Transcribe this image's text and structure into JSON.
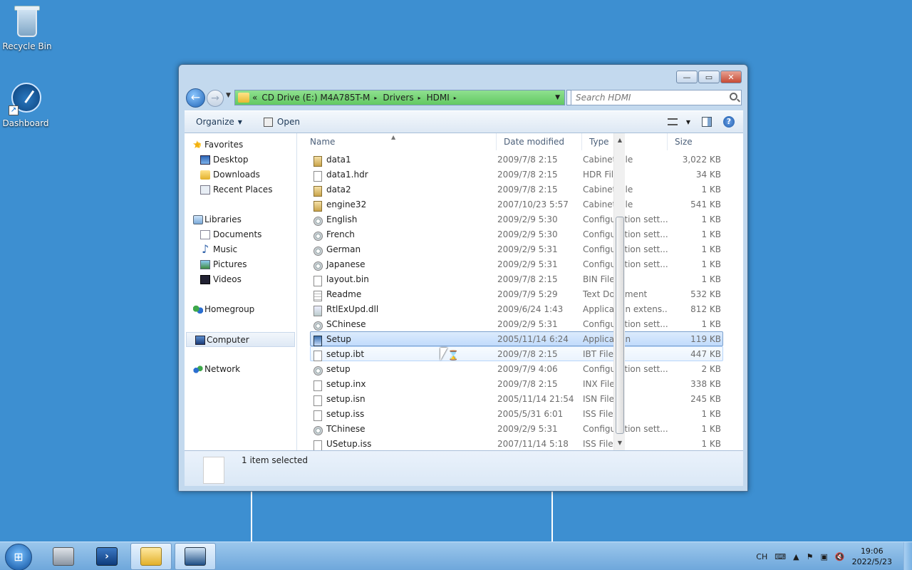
{
  "desktop": {
    "icons": [
      {
        "label": "Recycle Bin",
        "icon": "recycle-bin-icon"
      },
      {
        "label": "Dashboard",
        "icon": "dashboard-icon"
      }
    ]
  },
  "window": {
    "caption": {
      "minimize": "—",
      "maximize": "▭",
      "close": "✕"
    },
    "address": {
      "overflow": "«",
      "segments": [
        "CD Drive (E:) M4A785T-M",
        "Drivers",
        "HDMI"
      ],
      "separator": "▸"
    },
    "search": {
      "placeholder": "Search HDMI"
    },
    "toolbar": {
      "organize": "Organize",
      "open": "Open"
    },
    "nav": {
      "favorites": "Favorites",
      "favorites_items": [
        "Desktop",
        "Downloads",
        "Recent Places"
      ],
      "libraries": "Libraries",
      "libraries_items": [
        "Documents",
        "Music",
        "Pictures",
        "Videos"
      ],
      "homegroup": "Homegroup",
      "computer": "Computer",
      "network": "Network"
    },
    "columns": {
      "name": "Name",
      "date": "Date modified",
      "type": "Type",
      "size": "Size"
    },
    "files": [
      {
        "name": "data1",
        "date": "2009/7/8 2:15",
        "type": "Cabinet File",
        "size": "3,022 KB",
        "kind": "cab"
      },
      {
        "name": "data1.hdr",
        "date": "2009/7/8 2:15",
        "type": "HDR File",
        "size": "34 KB",
        "kind": "blank"
      },
      {
        "name": "data2",
        "date": "2009/7/8 2:15",
        "type": "Cabinet File",
        "size": "1 KB",
        "kind": "cab"
      },
      {
        "name": "engine32",
        "date": "2007/10/23 5:57",
        "type": "Cabinet File",
        "size": "541 KB",
        "kind": "cab"
      },
      {
        "name": "English",
        "date": "2009/2/9 5:30",
        "type": "Configuration sett...",
        "size": "1 KB",
        "kind": "cfg"
      },
      {
        "name": "French",
        "date": "2009/2/9 5:30",
        "type": "Configuration sett...",
        "size": "1 KB",
        "kind": "cfg"
      },
      {
        "name": "German",
        "date": "2009/2/9 5:31",
        "type": "Configuration sett...",
        "size": "1 KB",
        "kind": "cfg"
      },
      {
        "name": "Japanese",
        "date": "2009/2/9 5:31",
        "type": "Configuration sett...",
        "size": "1 KB",
        "kind": "cfg"
      },
      {
        "name": "layout.bin",
        "date": "2009/7/8 2:15",
        "type": "BIN File",
        "size": "1 KB",
        "kind": "blank"
      },
      {
        "name": "Readme",
        "date": "2009/7/9 5:29",
        "type": "Text Document",
        "size": "532 KB",
        "kind": "txt"
      },
      {
        "name": "RtlExUpd.dll",
        "date": "2009/6/24 1:43",
        "type": "Application extens...",
        "size": "812 KB",
        "kind": "dll"
      },
      {
        "name": "SChinese",
        "date": "2009/2/9 5:31",
        "type": "Configuration sett...",
        "size": "1 KB",
        "kind": "cfg"
      },
      {
        "name": "Setup",
        "date": "2005/11/14 6:24",
        "type": "Application",
        "size": "119 KB",
        "kind": "app",
        "state": "sel"
      },
      {
        "name": "setup.ibt",
        "date": "2009/7/8 2:15",
        "type": "IBT File",
        "size": "447 KB",
        "kind": "blank",
        "state": "hover"
      },
      {
        "name": "setup",
        "date": "2009/7/9 4:06",
        "type": "Configuration sett...",
        "size": "2 KB",
        "kind": "cfg"
      },
      {
        "name": "setup.inx",
        "date": "2009/7/8 2:15",
        "type": "INX File",
        "size": "338 KB",
        "kind": "blank"
      },
      {
        "name": "setup.isn",
        "date": "2005/11/14 21:54",
        "type": "ISN File",
        "size": "245 KB",
        "kind": "blank"
      },
      {
        "name": "setup.iss",
        "date": "2005/5/31 6:01",
        "type": "ISS File",
        "size": "1 KB",
        "kind": "blank"
      },
      {
        "name": "TChinese",
        "date": "2009/2/9 5:31",
        "type": "Configuration sett...",
        "size": "1 KB",
        "kind": "cfg"
      },
      {
        "name": "USetup.iss",
        "date": "2007/11/14 5:18",
        "type": "ISS File",
        "size": "1 KB",
        "kind": "blank"
      }
    ],
    "status": "1 item selected"
  },
  "taskbar": {
    "language": "CH",
    "time": "19:06",
    "date": "2022/5/23"
  },
  "colors": {
    "desktop": "#3d8fd1",
    "address_bar": "#62c962",
    "selection": "#c1dbfc"
  }
}
